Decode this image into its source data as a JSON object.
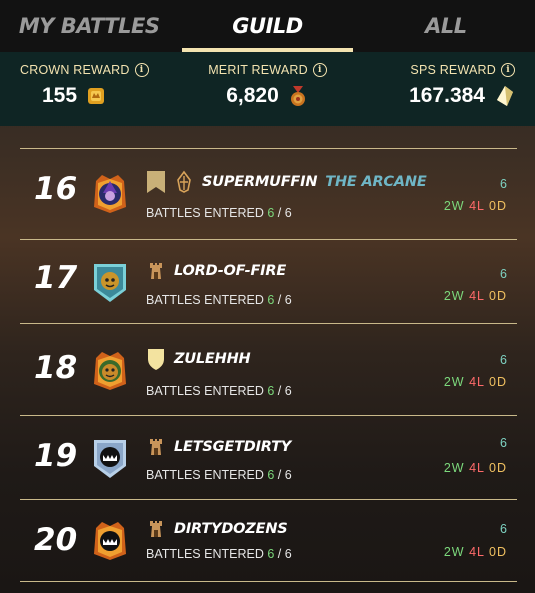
{
  "tabs": [
    {
      "label": "MY BATTLES",
      "active": false
    },
    {
      "label": "GUILD",
      "active": true
    },
    {
      "label": "ALL",
      "active": false
    }
  ],
  "rewards": {
    "crown": {
      "label": "CROWN REWARD",
      "value": "155",
      "icon": "crown-token-icon"
    },
    "merit": {
      "label": "MERIT REWARD",
      "value": "6,820",
      "icon": "merit-medal-icon"
    },
    "sps": {
      "label": "SPS REWARD",
      "value": "167.384",
      "icon": "sps-crystal-icon"
    }
  },
  "info_glyph": "i",
  "battles_label": "BATTLES ENTERED",
  "separator": "/",
  "rows": [
    {
      "rank": "16",
      "name": "SUPERMUFFIN",
      "title": "THE ARCANE",
      "entered": "6",
      "total": "6",
      "score": "6",
      "wins": "2",
      "losses": "4",
      "draws": "0",
      "win_letter": "W",
      "loss_letter": "L",
      "draw_letter": "D",
      "avatar": "wizard-avatar",
      "badges": [
        "banner-icon",
        "guild-crest-icon"
      ]
    },
    {
      "rank": "17",
      "name": "LORD-OF-FIRE",
      "title": "",
      "entered": "6",
      "total": "6",
      "score": "6",
      "wins": "2",
      "losses": "4",
      "draws": "0",
      "win_letter": "W",
      "loss_letter": "L",
      "draw_letter": "D",
      "avatar": "goblin-avatar",
      "badges": [
        "tower-icon"
      ]
    },
    {
      "rank": "18",
      "name": "ZULEHHH",
      "title": "",
      "entered": "6",
      "total": "6",
      "score": "6",
      "wins": "2",
      "losses": "4",
      "draws": "0",
      "win_letter": "W",
      "loss_letter": "L",
      "draw_letter": "D",
      "avatar": "pumpkin-avatar",
      "badges": [
        "shield-icon"
      ]
    },
    {
      "rank": "19",
      "name": "LETSGETDIRTY",
      "title": "",
      "entered": "6",
      "total": "6",
      "score": "6",
      "wins": "2",
      "losses": "4",
      "draws": "0",
      "win_letter": "W",
      "loss_letter": "L",
      "draw_letter": "D",
      "avatar": "monster-avatar",
      "badges": [
        "tower-icon"
      ]
    },
    {
      "rank": "20",
      "name": "DIRTYDOZENS",
      "title": "",
      "entered": "6",
      "total": "6",
      "score": "6",
      "wins": "2",
      "losses": "4",
      "draws": "0",
      "win_letter": "W",
      "loss_letter": "L",
      "draw_letter": "D",
      "avatar": "monster-gold-avatar",
      "badges": [
        "tower-icon"
      ]
    }
  ],
  "colors": {
    "accent": "#f3e3b0",
    "win": "#7cd87c",
    "loss": "#ff6a6a",
    "draw": "#f0c060",
    "title": "#6fb6c6"
  }
}
